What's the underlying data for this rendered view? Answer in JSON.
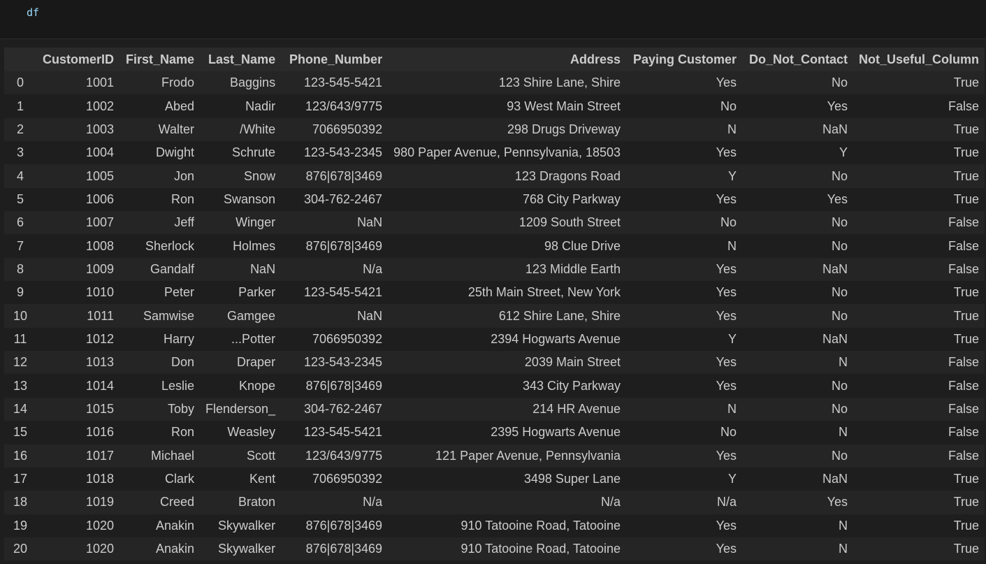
{
  "cell": {
    "code": "df"
  },
  "table": {
    "columns": [
      "CustomerID",
      "First_Name",
      "Last_Name",
      "Phone_Number",
      "Address",
      "Paying Customer",
      "Do_Not_Contact",
      "Not_Useful_Column"
    ],
    "rows": [
      [
        "0",
        "1001",
        "Frodo",
        "Baggins",
        "123-545-5421",
        "123 Shire Lane, Shire",
        "Yes",
        "No",
        "True"
      ],
      [
        "1",
        "1002",
        "Abed",
        "Nadir",
        "123/643/9775",
        "93 West Main Street",
        "No",
        "Yes",
        "False"
      ],
      [
        "2",
        "1003",
        "Walter",
        "/White",
        "7066950392",
        "298 Drugs Driveway",
        "N",
        "NaN",
        "True"
      ],
      [
        "3",
        "1004",
        "Dwight",
        "Schrute",
        "123-543-2345",
        "980 Paper Avenue, Pennsylvania, 18503",
        "Yes",
        "Y",
        "True"
      ],
      [
        "4",
        "1005",
        "Jon",
        "Snow",
        "876|678|3469",
        "123 Dragons Road",
        "Y",
        "No",
        "True"
      ],
      [
        "5",
        "1006",
        "Ron",
        "Swanson",
        "304-762-2467",
        "768 City Parkway",
        "Yes",
        "Yes",
        "True"
      ],
      [
        "6",
        "1007",
        "Jeff",
        "Winger",
        "NaN",
        "1209 South Street",
        "No",
        "No",
        "False"
      ],
      [
        "7",
        "1008",
        "Sherlock",
        "Holmes",
        "876|678|3469",
        "98 Clue Drive",
        "N",
        "No",
        "False"
      ],
      [
        "8",
        "1009",
        "Gandalf",
        "NaN",
        "N/a",
        "123 Middle Earth",
        "Yes",
        "NaN",
        "False"
      ],
      [
        "9",
        "1010",
        "Peter",
        "Parker",
        "123-545-5421",
        "25th Main Street, New York",
        "Yes",
        "No",
        "True"
      ],
      [
        "10",
        "1011",
        "Samwise",
        "Gamgee",
        "NaN",
        "612 Shire Lane, Shire",
        "Yes",
        "No",
        "True"
      ],
      [
        "11",
        "1012",
        "Harry",
        "...Potter",
        "7066950392",
        "2394 Hogwarts Avenue",
        "Y",
        "NaN",
        "True"
      ],
      [
        "12",
        "1013",
        "Don",
        "Draper",
        "123-543-2345",
        "2039 Main Street",
        "Yes",
        "N",
        "False"
      ],
      [
        "13",
        "1014",
        "Leslie",
        "Knope",
        "876|678|3469",
        "343 City Parkway",
        "Yes",
        "No",
        "False"
      ],
      [
        "14",
        "1015",
        "Toby",
        "Flenderson_",
        "304-762-2467",
        "214 HR Avenue",
        "N",
        "No",
        "False"
      ],
      [
        "15",
        "1016",
        "Ron",
        "Weasley",
        "123-545-5421",
        "2395 Hogwarts Avenue",
        "No",
        "N",
        "False"
      ],
      [
        "16",
        "1017",
        "Michael",
        "Scott",
        "123/643/9775",
        "121 Paper Avenue, Pennsylvania",
        "Yes",
        "No",
        "False"
      ],
      [
        "17",
        "1018",
        "Clark",
        "Kent",
        "7066950392",
        "3498 Super Lane",
        "Y",
        "NaN",
        "True"
      ],
      [
        "18",
        "1019",
        "Creed",
        "Braton",
        "N/a",
        "N/a",
        "N/a",
        "Yes",
        "True"
      ],
      [
        "19",
        "1020",
        "Anakin",
        "Skywalker",
        "876|678|3469",
        "910 Tatooine Road, Tatooine",
        "Yes",
        "N",
        "True"
      ],
      [
        "20",
        "1020",
        "Anakin",
        "Skywalker",
        "876|678|3469",
        "910 Tatooine Road, Tatooine",
        "Yes",
        "N",
        "True"
      ]
    ]
  }
}
